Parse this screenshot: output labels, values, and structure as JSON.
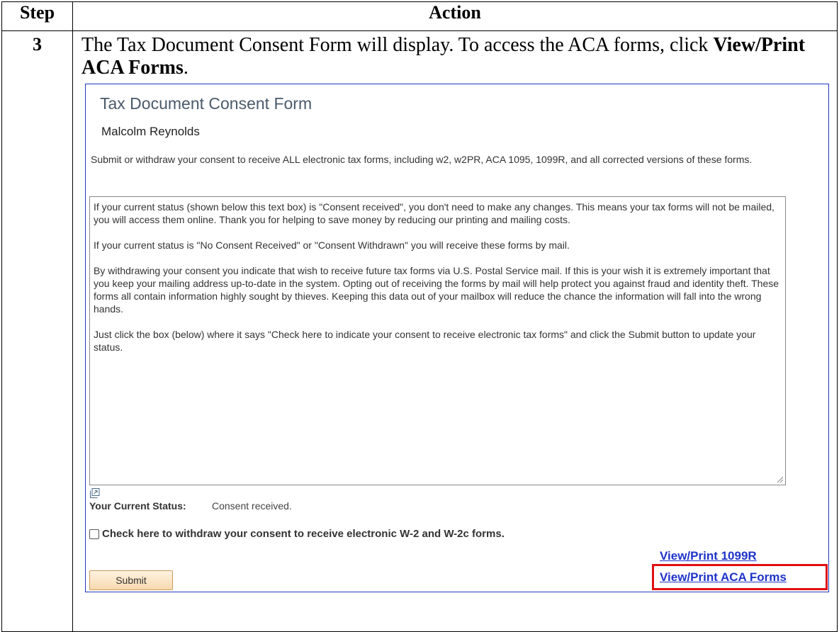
{
  "table": {
    "header_step": "Step",
    "header_action": "Action",
    "step_number": "3",
    "instruction_prefix": "The Tax Document Consent Form will display.  To access the ACA forms, click",
    "instruction_link_text": "View/Print ACA Forms",
    "instruction_suffix": "."
  },
  "form": {
    "title": "Tax Document Consent Form",
    "user_name": "Malcolm Reynolds",
    "intro": "Submit or withdraw your consent to receive ALL electronic tax forms, including w2, w2PR, ACA 1095, 1099R, and all corrected versions of these forms.",
    "textbox_paragraphs": [
      "If your current status (shown below this text box) is \"Consent received\", you don't need to make any changes. This means your tax forms will not be mailed, you will access them online. Thank you for helping to save money by reducing our printing and mailing costs.",
      "If your current status is \"No Consent Received\" or  \"Consent Withdrawn\" you will  receive these forms by mail.",
      "By withdrawing your consent you indicate that wish to receive future tax forms via U.S. Postal Service mail. If this is your wish it is extremely important that you keep your mailing address up-to-date in the system. Opting out of receiving the forms by mail will help protect you against fraud and identity theft. These forms all contain information highly sought by thieves. Keeping this data out of your mailbox will reduce the chance the information will fall into the wrong hands.",
      "Just click the box (below) where it says \"Check here to indicate your consent to receive electronic tax forms\" and click the Submit button to update your status."
    ],
    "status_label": "Your Current Status:",
    "status_value": "Consent received.",
    "withdraw_checkbox_label": "Check here to withdraw your consent to receive electronic W-2 and W-2c forms.",
    "withdraw_checked": false,
    "link_1099r": "View/Print 1099R",
    "link_aca": "View/Print ACA Forms",
    "submit_label": "Submit"
  },
  "colors": {
    "frame_border": "#2238b8",
    "link": "#1f33c9",
    "highlight": "#e01010",
    "title": "#4a5a6b"
  }
}
